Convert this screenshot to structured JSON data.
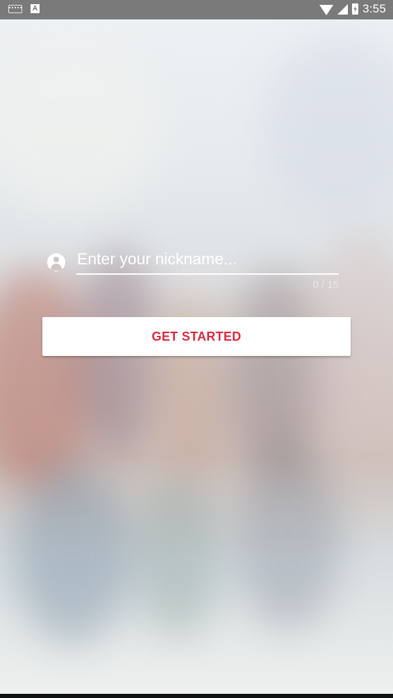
{
  "status_bar": {
    "time": "3:55",
    "icons": [
      "keyboard-icon",
      "a-icon",
      "wifi-icon",
      "cell-signal-icon",
      "battery-charging-icon"
    ],
    "a_icon_text": "A"
  },
  "form": {
    "nickname_placeholder": "Enter your nickname...",
    "nickname_value": "",
    "counter": "0 / 15",
    "icon": "account-circle-icon"
  },
  "actions": {
    "get_started_label": "GET STARTED"
  },
  "colors": {
    "accent": "#e0283e",
    "status_bar": "#7a7a7a"
  }
}
